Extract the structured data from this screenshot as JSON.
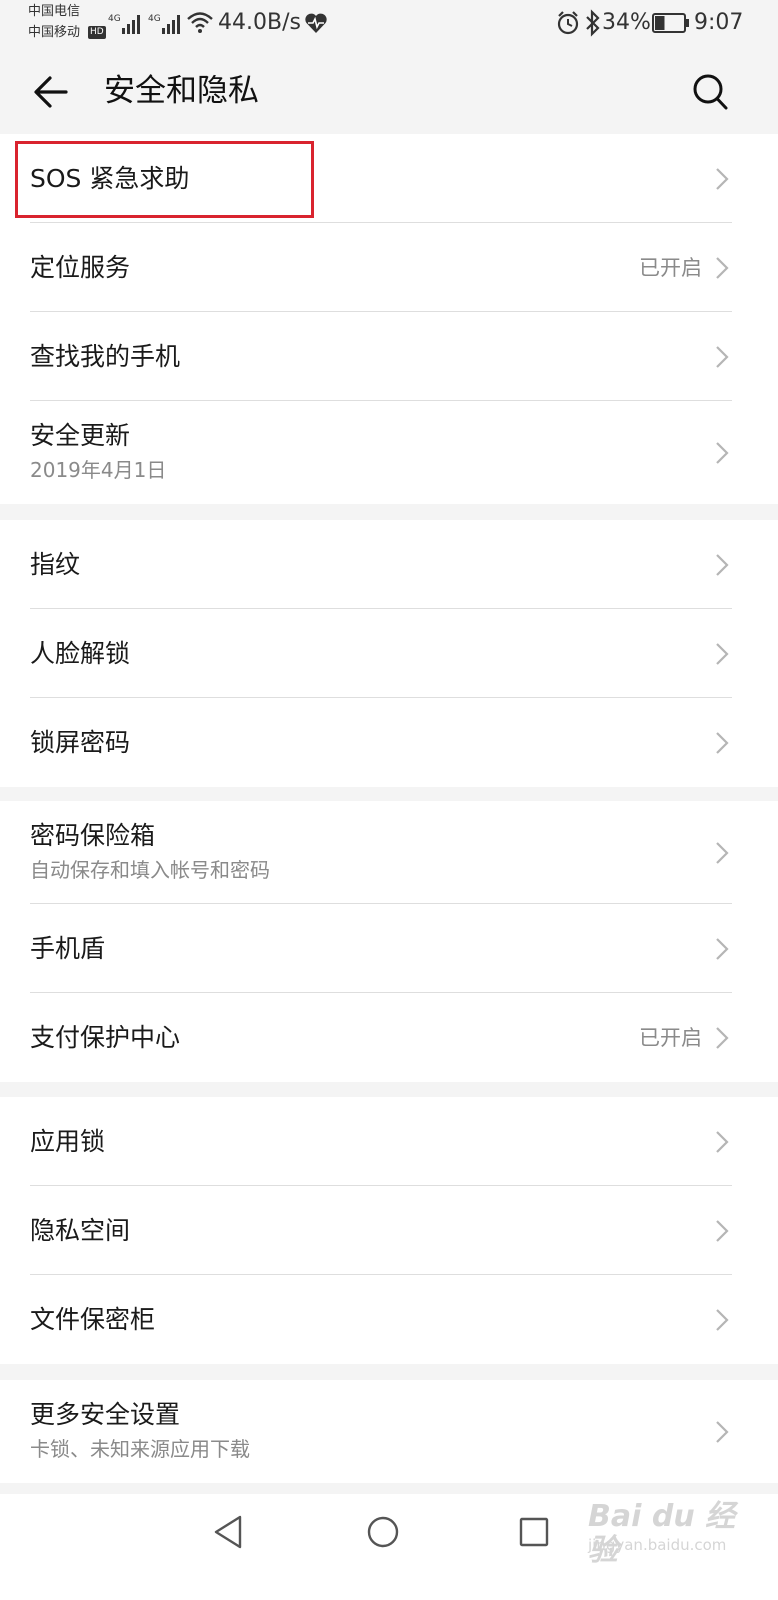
{
  "status_bar": {
    "carrier_1": "中国电信",
    "carrier_2": "中国移动",
    "hd": "HD",
    "network_1": "4G",
    "network_2": "4G",
    "net_speed": "44.0B/s",
    "battery": "34%",
    "battery_level": 0.34,
    "time": "9:07"
  },
  "header": {
    "title": "安全和隐私"
  },
  "groups": [
    {
      "items": [
        {
          "label": "SOS 紧急求助"
        },
        {
          "label": "定位服务",
          "value": "已开启"
        },
        {
          "label": "查找我的手机"
        },
        {
          "label": "安全更新",
          "sublabel": "2019年4月1日"
        }
      ]
    },
    {
      "items": [
        {
          "label": "指纹"
        },
        {
          "label": "人脸解锁"
        },
        {
          "label": "锁屏密码"
        }
      ]
    },
    {
      "items": [
        {
          "label": "密码保险箱",
          "sublabel": "自动保存和填入帐号和密码"
        },
        {
          "label": "手机盾"
        },
        {
          "label": "支付保护中心",
          "value": "已开启"
        }
      ]
    },
    {
      "items": [
        {
          "label": "应用锁"
        },
        {
          "label": "隐私空间"
        },
        {
          "label": "文件保密柜"
        }
      ]
    },
    {
      "items": [
        {
          "label": "更多安全设置",
          "sublabel": "卡锁、未知来源应用下载"
        }
      ]
    }
  ],
  "watermark": {
    "logo": "Bai du 经验",
    "url": "jingyan.baidu.com"
  },
  "colors": {
    "background": "#f4f4f4",
    "highlight": "#d9232e",
    "secondary_text": "#8a8a8a"
  }
}
